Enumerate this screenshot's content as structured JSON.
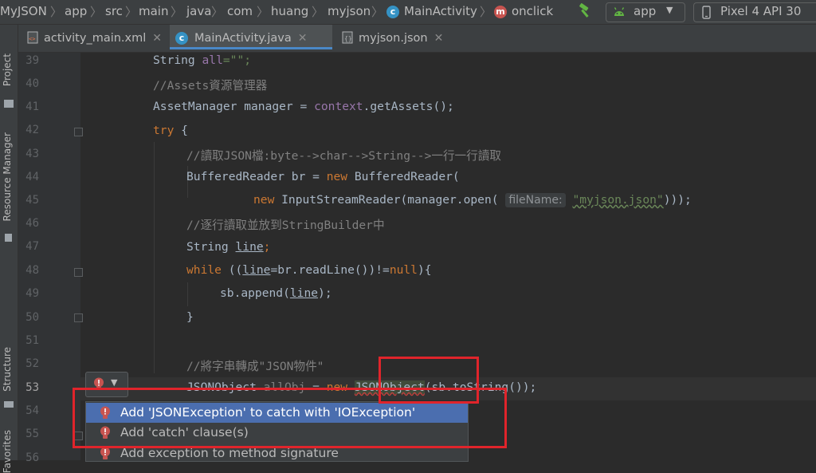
{
  "breadcrumb": {
    "items": [
      "MyJSON",
      "app",
      "src",
      "main",
      "java",
      "com",
      "huang",
      "myjson",
      "MainActivity",
      "onclick"
    ]
  },
  "toolbar": {
    "run_config": "app",
    "device": "Pixel 4 API 30",
    "build_icon": "hammer-icon"
  },
  "left_strip": {
    "tabs": [
      "Project",
      "Resource Manager",
      "Structure",
      "Favorites"
    ]
  },
  "file_tabs": [
    {
      "label": "activity_main.xml",
      "icon": "xml-file-icon",
      "active": false
    },
    {
      "label": "MainActivity.java",
      "icon": "class-file-icon",
      "active": true
    },
    {
      "label": "myjson.json",
      "icon": "json-file-icon",
      "active": false
    }
  ],
  "editor": {
    "line_numbers": [
      "39",
      "40",
      "41",
      "42",
      "43",
      "44",
      "45",
      "46",
      "47",
      "48",
      "49",
      "50",
      "51",
      "52",
      "53",
      "54",
      "55",
      "56"
    ],
    "current_line": "53",
    "param_hint": "fileName:",
    "lines": {
      "l39": {
        "t1": "String ",
        "t2": "all",
        "t3": "=\"\";"
      },
      "l40": "//Assets資源管理器",
      "l41": {
        "t1": "AssetManager manager = ",
        "t2": "context",
        "t3": ".getAssets();"
      },
      "l42": {
        "kw": "try",
        "rest": " {"
      },
      "l43": "//讀取JSON檔:byte-->char-->String-->一行一行讀取",
      "l44": {
        "t1": "BufferedReader br = ",
        "kw": "new",
        "t2": " BufferedReader("
      },
      "l45": {
        "kw": "new",
        "t1": " InputStreamReader(manager.open(",
        "str": "\"myjson.json\"",
        "t2": ")));"
      },
      "l46": "//逐行讀取並放到StringBuilder中",
      "l47": {
        "t1": "String ",
        "var": "line",
        "t2": ";"
      },
      "l48": {
        "kw": "while",
        "t1": " ((",
        "var": "line",
        "t2": "=br.readLine())!=",
        "kw2": "null",
        "t3": "){"
      },
      "l49": {
        "t1": "sb.append(",
        "var": "line",
        "t2": ");"
      },
      "l50": "}",
      "l52": "//將字串轉成\"JSON物件\"",
      "l53": {
        "t1": "JSONObject ",
        "t2": "allObj",
        "t3": " = ",
        "kw": "new",
        "t4": " ",
        "err": "JSONObject",
        "t5": "(sb.toString());"
      }
    }
  },
  "quickfix": {
    "items": [
      {
        "label": "Add 'JSONException' to catch with 'IOException'",
        "selected": true
      },
      {
        "label": "Add 'catch' clause(s)",
        "selected": false
      },
      {
        "label": "Add exception to method signature",
        "selected": false
      }
    ]
  },
  "colors": {
    "accent": "#4b6eaf",
    "annotation_red": "#e0242b",
    "error_bulb": "#c75450"
  }
}
